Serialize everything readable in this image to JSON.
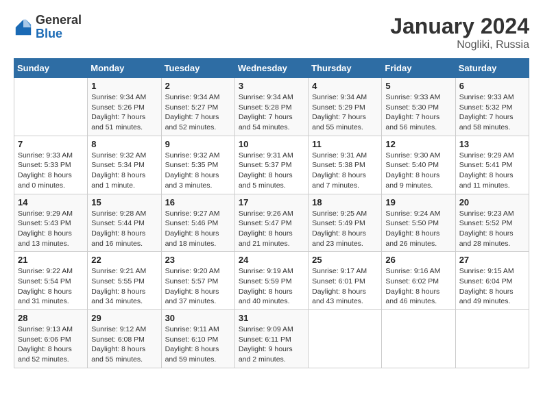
{
  "header": {
    "logo": {
      "line1": "General",
      "line2": "Blue"
    },
    "title": "January 2024",
    "subtitle": "Nogliki, Russia"
  },
  "days_of_week": [
    "Sunday",
    "Monday",
    "Tuesday",
    "Wednesday",
    "Thursday",
    "Friday",
    "Saturday"
  ],
  "weeks": [
    [
      {
        "num": "",
        "info": ""
      },
      {
        "num": "1",
        "info": "Sunrise: 9:34 AM\nSunset: 5:26 PM\nDaylight: 7 hours\nand 51 minutes."
      },
      {
        "num": "2",
        "info": "Sunrise: 9:34 AM\nSunset: 5:27 PM\nDaylight: 7 hours\nand 52 minutes."
      },
      {
        "num": "3",
        "info": "Sunrise: 9:34 AM\nSunset: 5:28 PM\nDaylight: 7 hours\nand 54 minutes."
      },
      {
        "num": "4",
        "info": "Sunrise: 9:34 AM\nSunset: 5:29 PM\nDaylight: 7 hours\nand 55 minutes."
      },
      {
        "num": "5",
        "info": "Sunrise: 9:33 AM\nSunset: 5:30 PM\nDaylight: 7 hours\nand 56 minutes."
      },
      {
        "num": "6",
        "info": "Sunrise: 9:33 AM\nSunset: 5:32 PM\nDaylight: 7 hours\nand 58 minutes."
      }
    ],
    [
      {
        "num": "7",
        "info": "Sunrise: 9:33 AM\nSunset: 5:33 PM\nDaylight: 8 hours\nand 0 minutes."
      },
      {
        "num": "8",
        "info": "Sunrise: 9:32 AM\nSunset: 5:34 PM\nDaylight: 8 hours\nand 1 minute."
      },
      {
        "num": "9",
        "info": "Sunrise: 9:32 AM\nSunset: 5:35 PM\nDaylight: 8 hours\nand 3 minutes."
      },
      {
        "num": "10",
        "info": "Sunrise: 9:31 AM\nSunset: 5:37 PM\nDaylight: 8 hours\nand 5 minutes."
      },
      {
        "num": "11",
        "info": "Sunrise: 9:31 AM\nSunset: 5:38 PM\nDaylight: 8 hours\nand 7 minutes."
      },
      {
        "num": "12",
        "info": "Sunrise: 9:30 AM\nSunset: 5:40 PM\nDaylight: 8 hours\nand 9 minutes."
      },
      {
        "num": "13",
        "info": "Sunrise: 9:29 AM\nSunset: 5:41 PM\nDaylight: 8 hours\nand 11 minutes."
      }
    ],
    [
      {
        "num": "14",
        "info": "Sunrise: 9:29 AM\nSunset: 5:43 PM\nDaylight: 8 hours\nand 13 minutes."
      },
      {
        "num": "15",
        "info": "Sunrise: 9:28 AM\nSunset: 5:44 PM\nDaylight: 8 hours\nand 16 minutes."
      },
      {
        "num": "16",
        "info": "Sunrise: 9:27 AM\nSunset: 5:46 PM\nDaylight: 8 hours\nand 18 minutes."
      },
      {
        "num": "17",
        "info": "Sunrise: 9:26 AM\nSunset: 5:47 PM\nDaylight: 8 hours\nand 21 minutes."
      },
      {
        "num": "18",
        "info": "Sunrise: 9:25 AM\nSunset: 5:49 PM\nDaylight: 8 hours\nand 23 minutes."
      },
      {
        "num": "19",
        "info": "Sunrise: 9:24 AM\nSunset: 5:50 PM\nDaylight: 8 hours\nand 26 minutes."
      },
      {
        "num": "20",
        "info": "Sunrise: 9:23 AM\nSunset: 5:52 PM\nDaylight: 8 hours\nand 28 minutes."
      }
    ],
    [
      {
        "num": "21",
        "info": "Sunrise: 9:22 AM\nSunset: 5:54 PM\nDaylight: 8 hours\nand 31 minutes."
      },
      {
        "num": "22",
        "info": "Sunrise: 9:21 AM\nSunset: 5:55 PM\nDaylight: 8 hours\nand 34 minutes."
      },
      {
        "num": "23",
        "info": "Sunrise: 9:20 AM\nSunset: 5:57 PM\nDaylight: 8 hours\nand 37 minutes."
      },
      {
        "num": "24",
        "info": "Sunrise: 9:19 AM\nSunset: 5:59 PM\nDaylight: 8 hours\nand 40 minutes."
      },
      {
        "num": "25",
        "info": "Sunrise: 9:17 AM\nSunset: 6:01 PM\nDaylight: 8 hours\nand 43 minutes."
      },
      {
        "num": "26",
        "info": "Sunrise: 9:16 AM\nSunset: 6:02 PM\nDaylight: 8 hours\nand 46 minutes."
      },
      {
        "num": "27",
        "info": "Sunrise: 9:15 AM\nSunset: 6:04 PM\nDaylight: 8 hours\nand 49 minutes."
      }
    ],
    [
      {
        "num": "28",
        "info": "Sunrise: 9:13 AM\nSunset: 6:06 PM\nDaylight: 8 hours\nand 52 minutes."
      },
      {
        "num": "29",
        "info": "Sunrise: 9:12 AM\nSunset: 6:08 PM\nDaylight: 8 hours\nand 55 minutes."
      },
      {
        "num": "30",
        "info": "Sunrise: 9:11 AM\nSunset: 6:10 PM\nDaylight: 8 hours\nand 59 minutes."
      },
      {
        "num": "31",
        "info": "Sunrise: 9:09 AM\nSunset: 6:11 PM\nDaylight: 9 hours\nand 2 minutes."
      },
      {
        "num": "",
        "info": ""
      },
      {
        "num": "",
        "info": ""
      },
      {
        "num": "",
        "info": ""
      }
    ]
  ]
}
